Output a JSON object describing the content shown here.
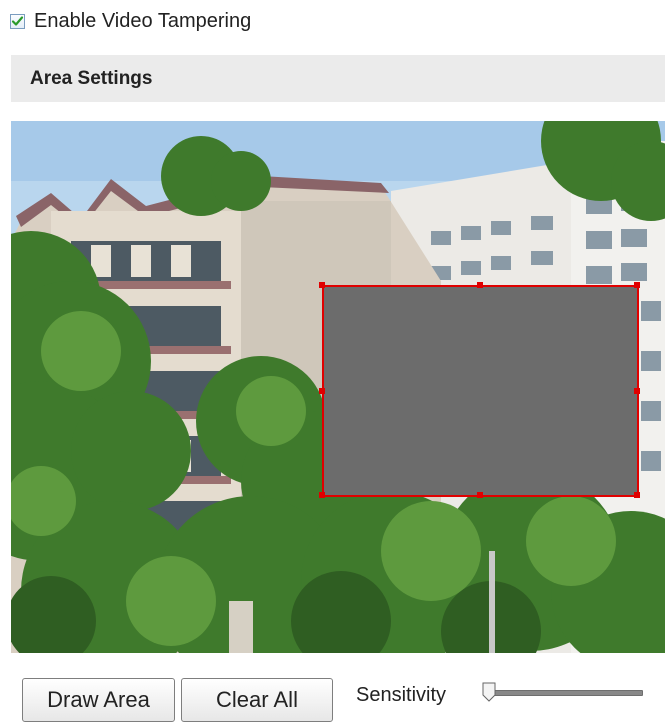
{
  "tampering": {
    "enabled": true,
    "label": "Enable Video Tampering"
  },
  "area_settings": {
    "title": "Area Settings"
  },
  "video_preview": {
    "tamper_area_color": "#6c6c6c",
    "border_color": "#e00000"
  },
  "controls": {
    "draw_area_label": "Draw Area",
    "clear_all_label": "Clear All",
    "sensitivity_label": "Sensitivity",
    "sensitivity_value": 0
  }
}
